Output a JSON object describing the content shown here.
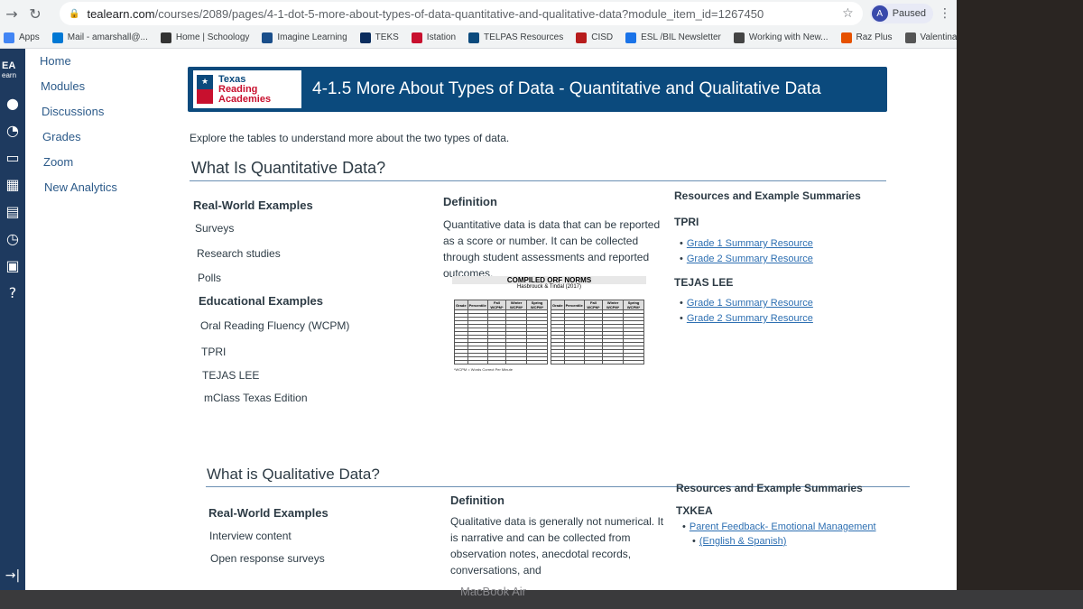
{
  "browser": {
    "url_host": "tealearn.com",
    "url_path": "/courses/2089/pages/4-1-dot-5-more-about-types-of-data-quantitative-and-qualitative-data?module_item_id=1267450",
    "profile_initial": "A",
    "profile_status": "Paused"
  },
  "bookmarks": [
    {
      "label": "Apps",
      "color": "#4285f4"
    },
    {
      "label": "Mail - amarshall@...",
      "color": "#0078d4"
    },
    {
      "label": "Home | Schoology",
      "color": "#333333"
    },
    {
      "label": "Imagine Learning",
      "color": "#1a4e8a"
    },
    {
      "label": "TEKS",
      "color": "#0b2d5e"
    },
    {
      "label": "Istation",
      "color": "#c8102e"
    },
    {
      "label": "TELPAS Resources",
      "color": "#0b4a7d"
    },
    {
      "label": "CISD",
      "color": "#b71c1c"
    },
    {
      "label": "ESL /BIL Newsletter",
      "color": "#1a73e8"
    },
    {
      "label": "Working with New...",
      "color": "#444444"
    },
    {
      "label": "Raz Plus",
      "color": "#e65100"
    },
    {
      "label": "Valentina-ESL",
      "color": "#555555"
    }
  ],
  "global_nav": {
    "logo": "EA",
    "logo_sub": "earn"
  },
  "course_nav": [
    "Home",
    "Modules",
    "Discussions",
    "Grades",
    "Zoom",
    "New Analytics"
  ],
  "banner": {
    "logo_texas": "Texas",
    "logo_reading": "Reading",
    "logo_academies": "Academies",
    "title": "4-1.5 More About Types of Data - Quantitative and Qualitative Data"
  },
  "intro": "Explore the tables to understand more about the two types of data.",
  "quant": {
    "heading": "What Is Quantitative Data?",
    "real_world_heading": "Real-World Examples",
    "real_world": [
      "Surveys",
      "Research studies",
      "Polls"
    ],
    "edu_heading": "Educational Examples",
    "edu": [
      "Oral Reading Fluency (WCPM)",
      "TPRI",
      "TEJAS LEE",
      "mClass Texas Edition"
    ],
    "def_heading": "Definition",
    "definition": "Quantitative data is data that can be reported as a score or number. It can be collected through student assessments and reported outcomes.",
    "res_heading": "Resources and Example Summaries",
    "groups": [
      {
        "name": "TPRI",
        "links": [
          "Grade 1 Summary Resource",
          "Grade 2 Summary Resource"
        ]
      },
      {
        "name": "TEJAS LEE",
        "links": [
          "Grade 1 Summary Resource",
          "Grade 2 Summary Resource"
        ]
      }
    ]
  },
  "orf": {
    "title": "COMPILED ORF NORMS",
    "subtitle": "Hasbrouck & Tindal (2017)",
    "headers": [
      "Grade",
      "Percentile",
      "Fall WCPM*",
      "Winter WCPM*",
      "Spring WCPM*"
    ],
    "footnote": "*WCPM = Words Correct Per Minute"
  },
  "qual": {
    "heading": "What is Qualitative Data?",
    "real_world_heading": "Real-World Examples",
    "real_world": [
      "Interview content",
      "Open response surveys"
    ],
    "def_heading": "Definition",
    "definition": "Qualitative data is generally not numerical. It is narrative and can be collected from observation notes, anecdotal records, conversations, and",
    "res_heading": "Resources and Example Summaries",
    "group_name": "TXKEA",
    "link": "Parent Feedback- Emotional Management",
    "link_cont": "(English & Spanish)"
  },
  "device": {
    "label": "MacBook Air"
  }
}
